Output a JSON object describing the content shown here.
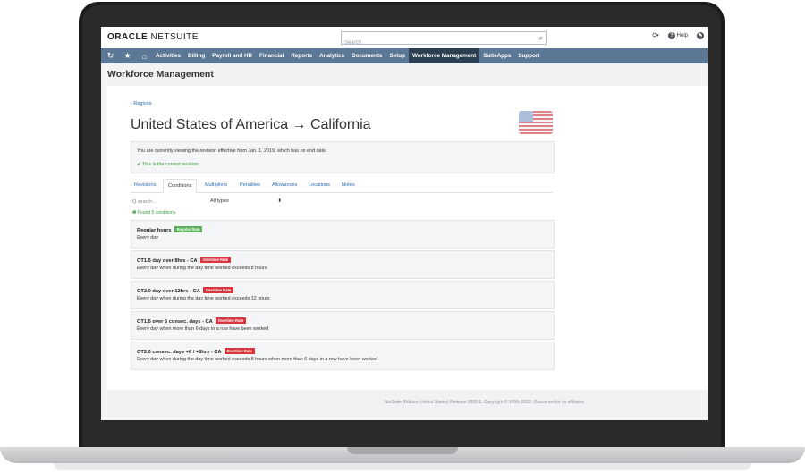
{
  "brand": {
    "logo_bold": "ORACLE",
    "logo_light": " NETSUITE"
  },
  "search": {
    "placeholder": "Search"
  },
  "top_right": {
    "help_label": "Help"
  },
  "nav": {
    "items": [
      "Activities",
      "Billing",
      "Payroll and HR",
      "Financial",
      "Reports",
      "Analytics",
      "Documents",
      "Setup",
      "Workforce Management",
      "SuiteApps",
      "Support"
    ],
    "active": "Workforce Management"
  },
  "page_title": "Workforce Management",
  "back_link": "‹ Regions",
  "heading": "United States of America → California",
  "info": {
    "line1": "You are currently viewing the revision effective from Jan. 1, 2019, which has no end date.",
    "line2": "✔ This is the current revision."
  },
  "tabs": [
    {
      "label": "Revisions"
    },
    {
      "label": "Conditions",
      "active": true
    },
    {
      "label": "Multipliers"
    },
    {
      "label": "Penalties"
    },
    {
      "label": "Allowances"
    },
    {
      "label": "Locations"
    },
    {
      "label": "Notes"
    }
  ],
  "filter": {
    "search_placeholder": "Q search...",
    "type_value": "All types",
    "found_text": "❶ Found 5 conditions."
  },
  "conditions": [
    {
      "title": "Regular hours",
      "badge": "Regular Rate",
      "badge_type": "regular",
      "desc": "Every day"
    },
    {
      "title": "OT1.5 day over 8hrs - CA",
      "badge": "Overtime Rate",
      "badge_type": "overtime",
      "desc": "Every day when during the day time worked exceeds 8 hours"
    },
    {
      "title": "OT2.0 day over 12hrs - CA",
      "badge": "Overtime Rate",
      "badge_type": "overtime",
      "desc": "Every day when during the day time worked exceeds 12 hours"
    },
    {
      "title": "OT1.5 over 6 consec. days - CA",
      "badge": "Overtime Rate",
      "badge_type": "overtime",
      "desc": "Every day when more than 6 days in a row have been worked"
    },
    {
      "title": "OT2.0 consec. days +6 / +8hrs - CA",
      "badge": "Overtime Rate",
      "badge_type": "overtime",
      "desc": "Every day when during the day time worked exceeds 8 hours when more than 6 days in a row have been worked"
    }
  ],
  "footer": "NetSuite (Edition: United States) Release 2022.1, Copyright © 1999, 2022, Oracle and/or its affiliates.",
  "colors": {
    "nav_bg": "#5b7896",
    "nav_active": "#2c3e52",
    "link": "#2e6ab5",
    "success": "#3c9a3c",
    "regular_badge": "#5ab15a",
    "overtime_badge": "#d9353f"
  }
}
